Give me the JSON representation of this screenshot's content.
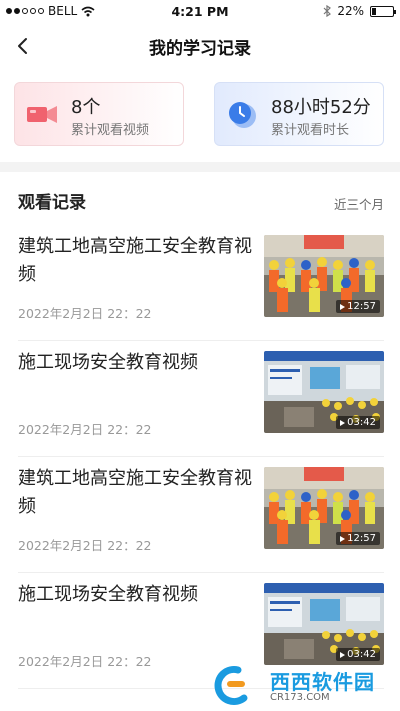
{
  "status_bar": {
    "carrier": "BELL",
    "time": "4:21 PM",
    "battery": "22%",
    "battery_fraction": 0.22
  },
  "navbar": {
    "title": "我的学习记录"
  },
  "stats": {
    "videos": {
      "value": "8个",
      "label": "累计观看视频",
      "icon": "video-camera-icon",
      "accent": "#f0626e"
    },
    "duration": {
      "value": "88小时52分",
      "label": "累计观看时长",
      "icon": "clock-icon",
      "accent": "#3a7ce8"
    }
  },
  "section": {
    "title": "观看记录",
    "filter": "近三个月"
  },
  "records": [
    {
      "title": "建筑工地高空施工安全教育视频",
      "date": "2022年2月2日 22：22",
      "duration": "12:57"
    },
    {
      "title": "施工现场安全教育视频",
      "date": "2022年2月2日 22：22",
      "duration": "03:42"
    },
    {
      "title": "建筑工地高空施工安全教育视频",
      "date": "2022年2月2日 22：22",
      "duration": "12:57"
    },
    {
      "title": "施工现场安全教育视频",
      "date": "2022年2月2日 22：22",
      "duration": "03:42"
    }
  ],
  "watermark": {
    "brand": "西西软件园",
    "url": "CR173.COM"
  }
}
